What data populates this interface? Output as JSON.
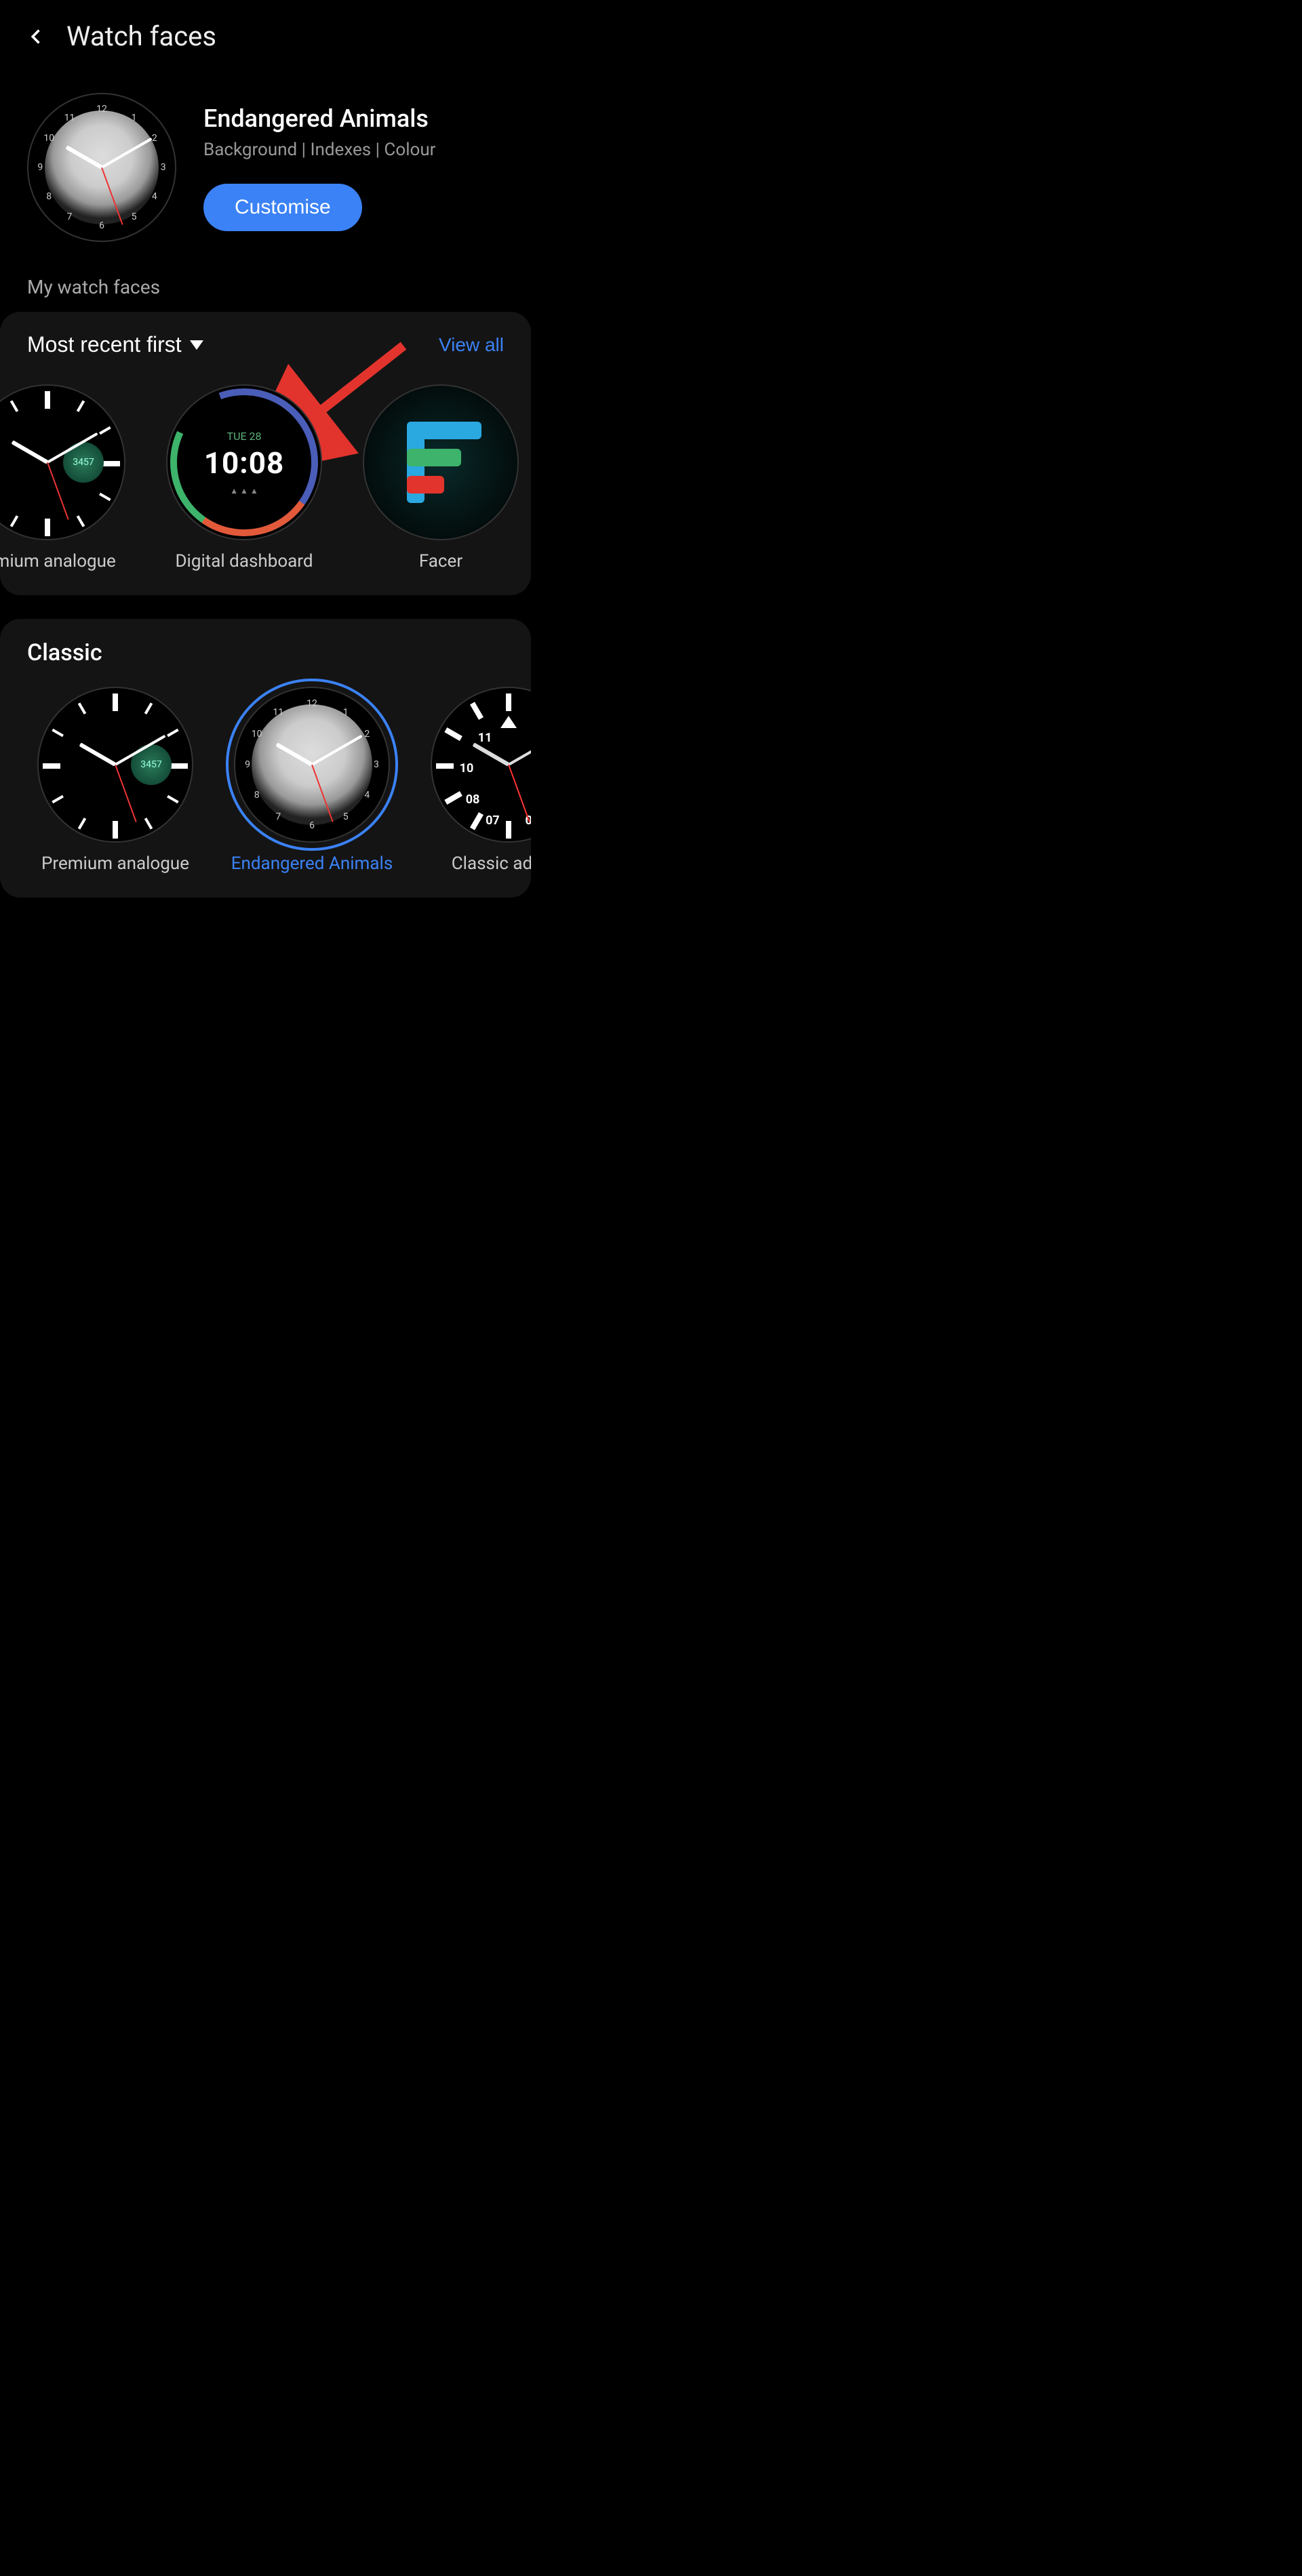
{
  "header": {
    "title": "Watch faces"
  },
  "current": {
    "title": "Endangered Animals",
    "subtitle": "Background | Indexes | Colour",
    "button": "Customise"
  },
  "my_faces": {
    "section_label": "My watch faces",
    "sort_label": "Most recent first",
    "view_all": "View all",
    "items": [
      {
        "label": "remium analogue"
      },
      {
        "label": "Digital dashboard",
        "date": "TUE 28",
        "time": "10:08"
      },
      {
        "label": "Facer"
      }
    ]
  },
  "classic": {
    "title": "Classic",
    "items": [
      {
        "label": "Premium analogue"
      },
      {
        "label": "Endangered Animals",
        "selected": true
      },
      {
        "label": "Classic advent"
      }
    ]
  },
  "colors": {
    "accent": "#3b82f6",
    "arrow": "#e2342d"
  }
}
